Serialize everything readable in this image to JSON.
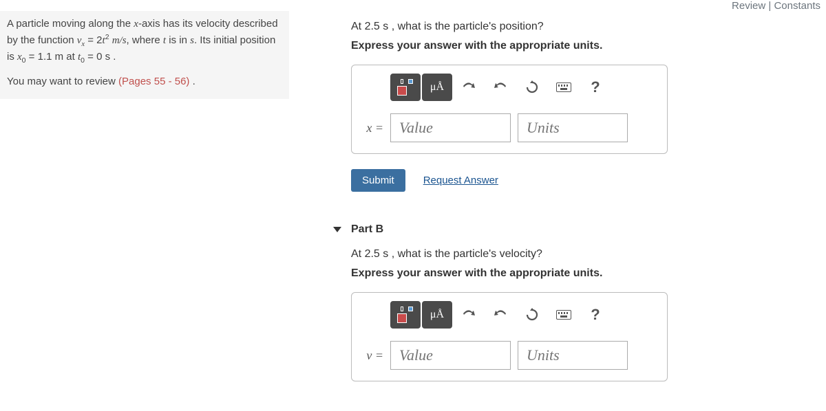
{
  "top": {
    "review": "Review",
    "constants": "Constants"
  },
  "left": {
    "problem_html": "A particle moving along the <span class='math-i'>x</span>-axis has its velocity described by the function <span class='math-i'>v<sub>x</sub></span> = 2<span class='math-i'>t</span><sup>2</sup> <span class='math-i'>m/s</span>, where <span class='math-i'>t</span> is in <span class='math-i'>s</span>. Its initial position is <span class='math-i'>x</span><sub>0</sub> = 1.1 m at <span class='math-i'>t</span><sub>0</sub> = 0 s .",
    "review_prefix": "You may want to review ",
    "review_link": "(Pages 55 - 56)",
    "review_suffix": " ."
  },
  "partA": {
    "question": "At 2.5 s , what is the particle's position?",
    "express": "Express your answer with the appropriate units.",
    "units_label": "μÅ",
    "help": "?",
    "var": "x =",
    "value_placeholder": "Value",
    "units_placeholder": "Units",
    "submit": "Submit",
    "request": "Request Answer"
  },
  "partB": {
    "title": "Part B",
    "question": "At 2.5 s , what is the particle's velocity?",
    "express": "Express your answer with the appropriate units.",
    "units_label": "μÅ",
    "help": "?",
    "var": "v =",
    "value_placeholder": "Value",
    "units_placeholder": "Units"
  }
}
